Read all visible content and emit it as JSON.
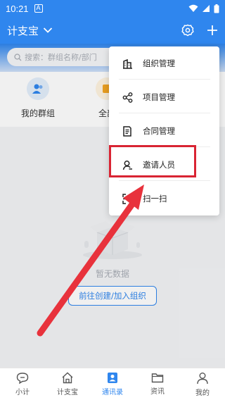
{
  "status_bar": {
    "time": "10:21",
    "badge": "A"
  },
  "app_bar": {
    "title": "计支宝"
  },
  "search": {
    "placeholder": "搜索：群组名称/部门"
  },
  "quick_actions": [
    {
      "label": "我的群组",
      "icon": "group-icon"
    },
    {
      "label": "全部",
      "icon": "all-icon"
    }
  ],
  "empty_state": {
    "text": "暂无数据",
    "button_label": "前往创建/加入组织"
  },
  "dropdown_menu": {
    "items": [
      {
        "label": "组织管理",
        "icon": "building-icon"
      },
      {
        "label": "项目管理",
        "icon": "share-nodes-icon"
      },
      {
        "label": "合同管理",
        "icon": "document-icon"
      },
      {
        "label": "邀请人员",
        "icon": "invite-person-icon"
      },
      {
        "label": "扫一扫",
        "icon": "scan-icon"
      }
    ],
    "highlighted": "邀请人员"
  },
  "tab_bar": {
    "tabs": [
      {
        "label": "小计",
        "icon": "chat-icon"
      },
      {
        "label": "计支宝",
        "icon": "home-icon"
      },
      {
        "label": "通讯录",
        "icon": "contacts-icon",
        "active": true
      },
      {
        "label": "资讯",
        "icon": "folder-icon"
      },
      {
        "label": "我的",
        "icon": "profile-icon"
      }
    ]
  },
  "colors": {
    "primary": "#2f86ee",
    "highlight": "#d92433",
    "arrow": "#e8323c"
  }
}
